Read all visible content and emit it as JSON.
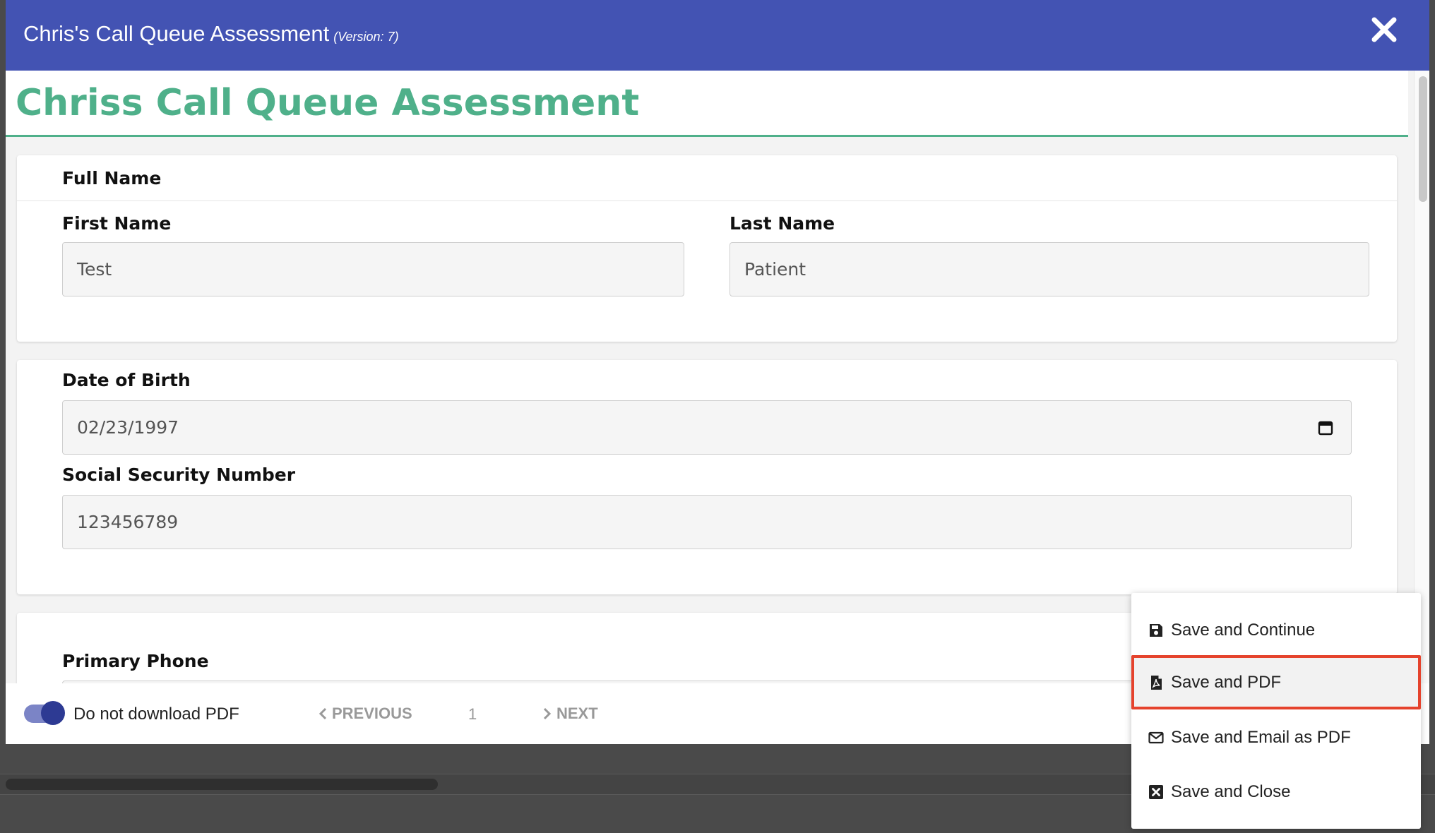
{
  "modal": {
    "title": "Chris's Call Queue Assessment",
    "version": "(Version: 7)",
    "close_icon": "close-x-icon"
  },
  "form": {
    "heading": "Chriss Call Queue Assessment",
    "full_name_section": {
      "title": "Full Name",
      "first_name": {
        "label": "First Name",
        "value": "Test"
      },
      "last_name": {
        "label": "Last Name",
        "value": "Patient"
      }
    },
    "dob": {
      "label": "Date of Birth",
      "value": "02/23/1997",
      "icon": "calendar-icon"
    },
    "ssn": {
      "label": "Social Security Number",
      "value": "123456789"
    },
    "primary_phone": {
      "label": "Primary Phone"
    }
  },
  "footer": {
    "toggle_label": "Do not download PDF",
    "toggle_on": true,
    "previous_label": "PREVIOUS",
    "page_number": "1",
    "next_label": "NEXT"
  },
  "dropdown": {
    "items": [
      {
        "label": "Save and Continue",
        "icon": "floppy-disk-icon"
      },
      {
        "label": "Save and PDF",
        "icon": "pdf-file-icon",
        "highlighted": true
      },
      {
        "label": "Save and Email as PDF",
        "icon": "envelope-icon"
      },
      {
        "label": "Save and Close",
        "icon": "close-square-icon"
      }
    ]
  },
  "colors": {
    "header_bg": "#4353b3",
    "heading_green": "#4fb08a",
    "highlight_border": "#e5432d",
    "toggle_knob": "#2d3a93"
  }
}
